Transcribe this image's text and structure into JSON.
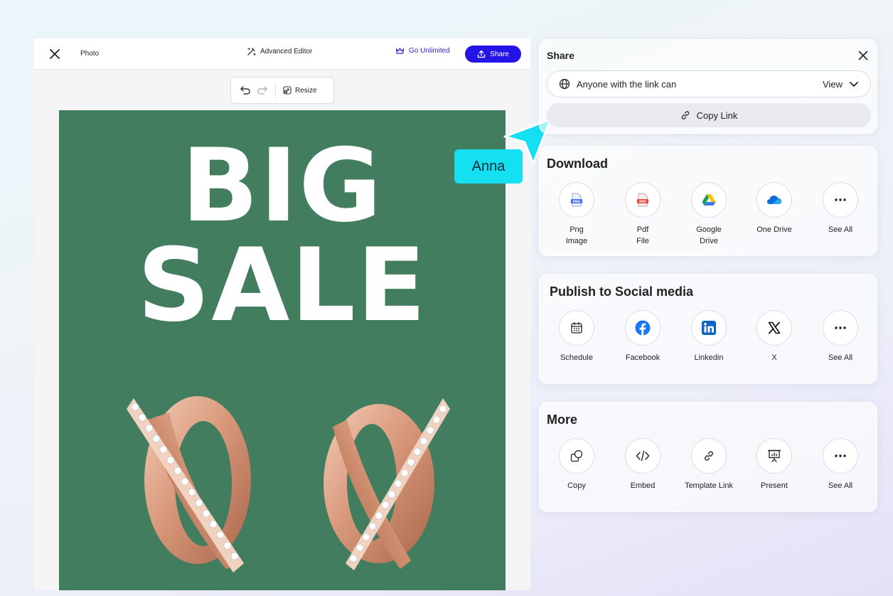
{
  "editor": {
    "title": "Photo",
    "advanced_editor": "Advanced Editor",
    "go_unlimited": "Go Unlimited",
    "share_button": "Share",
    "resize": "Resize"
  },
  "canvas": {
    "line1": "BIG",
    "line2": "SALE",
    "background_color": "#437d5f"
  },
  "cursor": {
    "name": "Anna",
    "color": "#14e0f2"
  },
  "share_panel": {
    "title": "Share",
    "access_label": "Anyone with the link can",
    "access_value": "View",
    "copy_link": "Copy Link"
  },
  "download": {
    "title": "Download",
    "options": [
      {
        "label": "Png\nImage",
        "icon": "png-file-icon"
      },
      {
        "label": "Pdf\nFile",
        "icon": "pdf-file-icon"
      },
      {
        "label": "Google\nDrive",
        "icon": "google-drive-icon"
      },
      {
        "label": "One Drive",
        "icon": "onedrive-icon"
      },
      {
        "label": "See All",
        "icon": "more-icon"
      }
    ]
  },
  "social": {
    "title": "Publish to Social media",
    "options": [
      {
        "label": "Schedule",
        "icon": "calendar-icon"
      },
      {
        "label": "Facebook",
        "icon": "facebook-icon"
      },
      {
        "label": "Linkedin",
        "icon": "linkedin-icon"
      },
      {
        "label": "X",
        "icon": "x-icon"
      },
      {
        "label": "See All",
        "icon": "more-icon"
      }
    ]
  },
  "more": {
    "title": "More",
    "options": [
      {
        "label": "Copy",
        "icon": "copy-icon"
      },
      {
        "label": "Embed",
        "icon": "code-icon"
      },
      {
        "label": "Template Link",
        "icon": "link-icon"
      },
      {
        "label": "Present",
        "icon": "presentation-icon"
      },
      {
        "label": "See All",
        "icon": "more-icon"
      }
    ]
  },
  "colors": {
    "accent": "#2414e6",
    "facebook": "#1877f2",
    "linkedin": "#0a66c2"
  }
}
